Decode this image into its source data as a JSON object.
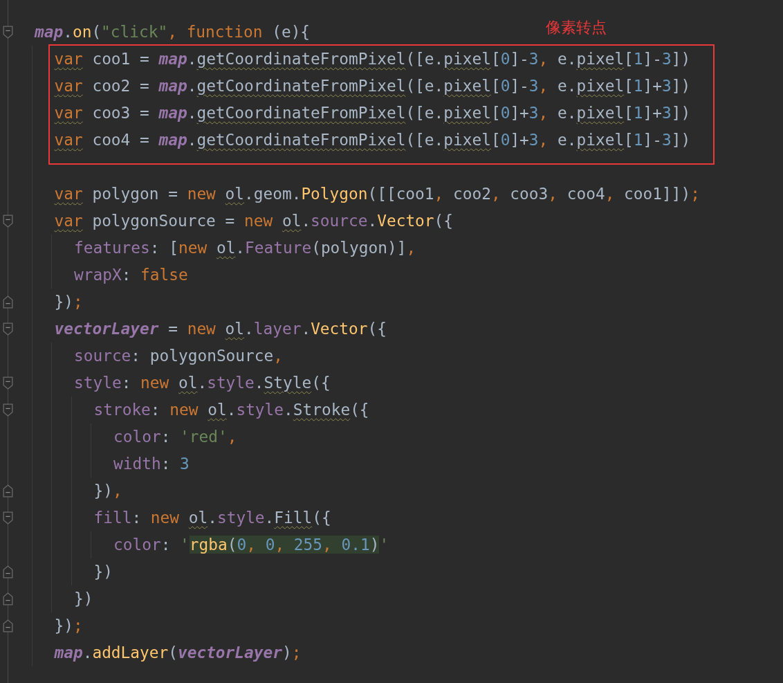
{
  "annotation": {
    "label": "像素转点"
  },
  "lines": [
    {
      "collapsible": true,
      "tokens": [
        {
          "kind": "glob",
          "text": "map"
        },
        {
          "kind": "id",
          "text": "."
        },
        {
          "kind": "fn",
          "text": "on"
        },
        {
          "kind": "id",
          "text": "("
        },
        {
          "kind": "str",
          "text": "\"click\""
        },
        {
          "kind": "sep",
          "text": ", "
        },
        {
          "kind": "kw",
          "text": "function"
        },
        {
          "kind": "id",
          "text": " (e){"
        }
      ],
      "children": [
        {
          "boxed": true,
          "tokens": [
            {
              "kind": "kw",
              "text": "var",
              "squiggle": true
            },
            {
              "kind": "id",
              "text": " coo1 = "
            },
            {
              "kind": "glob",
              "text": "map"
            },
            {
              "kind": "id",
              "text": "."
            },
            {
              "kind": "id",
              "text": "getCoordinateFromPixel",
              "squiggle": true
            },
            {
              "kind": "id",
              "text": "([e."
            },
            {
              "kind": "id",
              "text": "pixel",
              "squiggle": true
            },
            {
              "kind": "id",
              "text": "["
            },
            {
              "kind": "num",
              "text": "0"
            },
            {
              "kind": "id",
              "text": "]-"
            },
            {
              "kind": "num",
              "text": "3"
            },
            {
              "kind": "sep",
              "text": ","
            },
            {
              "kind": "id",
              "text": " e."
            },
            {
              "kind": "id",
              "text": "pixel",
              "squiggle": true
            },
            {
              "kind": "id",
              "text": "["
            },
            {
              "kind": "num",
              "text": "1"
            },
            {
              "kind": "id",
              "text": "]-"
            },
            {
              "kind": "num",
              "text": "3"
            },
            {
              "kind": "id",
              "text": "])"
            }
          ]
        },
        {
          "boxed": true,
          "tokens": [
            {
              "kind": "kw",
              "text": "var",
              "squiggle": true
            },
            {
              "kind": "id",
              "text": " coo2 = "
            },
            {
              "kind": "glob",
              "text": "map"
            },
            {
              "kind": "id",
              "text": "."
            },
            {
              "kind": "id",
              "text": "getCoordinateFromPixel",
              "squiggle": true
            },
            {
              "kind": "id",
              "text": "([e."
            },
            {
              "kind": "id",
              "text": "pixel",
              "squiggle": true
            },
            {
              "kind": "id",
              "text": "["
            },
            {
              "kind": "num",
              "text": "0"
            },
            {
              "kind": "id",
              "text": "]-"
            },
            {
              "kind": "num",
              "text": "3"
            },
            {
              "kind": "sep",
              "text": ","
            },
            {
              "kind": "id",
              "text": " e."
            },
            {
              "kind": "id",
              "text": "pixel",
              "squiggle": true
            },
            {
              "kind": "id",
              "text": "["
            },
            {
              "kind": "num",
              "text": "1"
            },
            {
              "kind": "id",
              "text": "]+"
            },
            {
              "kind": "num",
              "text": "3"
            },
            {
              "kind": "id",
              "text": "])"
            }
          ]
        },
        {
          "boxed": true,
          "tokens": [
            {
              "kind": "kw",
              "text": "var",
              "squiggle": true
            },
            {
              "kind": "id",
              "text": " coo3 = "
            },
            {
              "kind": "glob",
              "text": "map"
            },
            {
              "kind": "id",
              "text": "."
            },
            {
              "kind": "id",
              "text": "getCoordinateFromPixel",
              "squiggle": true
            },
            {
              "kind": "id",
              "text": "([e."
            },
            {
              "kind": "id",
              "text": "pixel",
              "squiggle": true
            },
            {
              "kind": "id",
              "text": "["
            },
            {
              "kind": "num",
              "text": "0"
            },
            {
              "kind": "id",
              "text": "]+"
            },
            {
              "kind": "num",
              "text": "3"
            },
            {
              "kind": "sep",
              "text": ","
            },
            {
              "kind": "id",
              "text": " e."
            },
            {
              "kind": "id",
              "text": "pixel",
              "squiggle": true
            },
            {
              "kind": "id",
              "text": "["
            },
            {
              "kind": "num",
              "text": "1"
            },
            {
              "kind": "id",
              "text": "]+"
            },
            {
              "kind": "num",
              "text": "3"
            },
            {
              "kind": "id",
              "text": "])"
            }
          ]
        },
        {
          "boxed": true,
          "tokens": [
            {
              "kind": "kw",
              "text": "var",
              "squiggle": true
            },
            {
              "kind": "id",
              "text": " coo4 = "
            },
            {
              "kind": "glob",
              "text": "map"
            },
            {
              "kind": "id",
              "text": "."
            },
            {
              "kind": "id",
              "text": "getCoordinateFromPixel",
              "squiggle": true
            },
            {
              "kind": "id",
              "text": "([e."
            },
            {
              "kind": "id",
              "text": "pixel",
              "squiggle": true
            },
            {
              "kind": "id",
              "text": "["
            },
            {
              "kind": "num",
              "text": "0"
            },
            {
              "kind": "id",
              "text": "]+"
            },
            {
              "kind": "num",
              "text": "3"
            },
            {
              "kind": "sep",
              "text": ","
            },
            {
              "kind": "id",
              "text": " e."
            },
            {
              "kind": "id",
              "text": "pixel",
              "squiggle": true
            },
            {
              "kind": "id",
              "text": "["
            },
            {
              "kind": "num",
              "text": "1"
            },
            {
              "kind": "id",
              "text": "]-"
            },
            {
              "kind": "num",
              "text": "3"
            },
            {
              "kind": "id",
              "text": "])"
            }
          ]
        },
        {
          "blank": true
        },
        {
          "tokens": [
            {
              "kind": "kw",
              "text": "var",
              "squiggle": true
            },
            {
              "kind": "id",
              "text": " polygon = "
            },
            {
              "kind": "kw",
              "text": "new "
            },
            {
              "kind": "id",
              "text": "ol",
              "squiggle": true
            },
            {
              "kind": "id",
              "text": ".geom."
            },
            {
              "kind": "fn",
              "text": "Polygon"
            },
            {
              "kind": "id",
              "text": "([[coo1"
            },
            {
              "kind": "sep",
              "text": ","
            },
            {
              "kind": "id",
              "text": " coo2"
            },
            {
              "kind": "sep",
              "text": ","
            },
            {
              "kind": "id",
              "text": " coo3"
            },
            {
              "kind": "sep",
              "text": ","
            },
            {
              "kind": "id",
              "text": " coo4"
            },
            {
              "kind": "sep",
              "text": ","
            },
            {
              "kind": "id",
              "text": " coo1]])"
            },
            {
              "kind": "sep",
              "text": ";"
            }
          ]
        },
        {
          "collapsible": true,
          "tokens": [
            {
              "kind": "kw",
              "text": "var",
              "squiggle": true
            },
            {
              "kind": "id",
              "text": " polygonSource = "
            },
            {
              "kind": "kw",
              "text": "new "
            },
            {
              "kind": "id",
              "text": "ol",
              "squiggle": true
            },
            {
              "kind": "id",
              "text": "."
            },
            {
              "kind": "prop",
              "text": "source"
            },
            {
              "kind": "id",
              "text": "."
            },
            {
              "kind": "fn",
              "text": "Vector"
            },
            {
              "kind": "id",
              "text": "({"
            }
          ],
          "children": [
            {
              "tokens": [
                {
                  "kind": "prop",
                  "text": "features"
                },
                {
                  "kind": "id",
                  "text": ": ["
                },
                {
                  "kind": "kw",
                  "text": "new "
                },
                {
                  "kind": "id",
                  "text": "ol",
                  "squiggle": true
                },
                {
                  "kind": "id",
                  "text": "."
                },
                {
                  "kind": "prop",
                  "text": "Feature"
                },
                {
                  "kind": "id",
                  "text": "(polygon)]"
                },
                {
                  "kind": "sep",
                  "text": ","
                }
              ]
            },
            {
              "tokens": [
                {
                  "kind": "prop",
                  "text": "wrapX"
                },
                {
                  "kind": "id",
                  "text": ": "
                },
                {
                  "kind": "kw",
                  "text": "false"
                }
              ]
            }
          ]
        },
        {
          "block_end": true,
          "tokens": [
            {
              "kind": "id",
              "text": "})"
            },
            {
              "kind": "sep",
              "text": ";"
            }
          ]
        },
        {
          "collapsible": true,
          "tokens": [
            {
              "kind": "glob",
              "text": "vectorLayer"
            },
            {
              "kind": "id",
              "text": " = "
            },
            {
              "kind": "kw",
              "text": "new "
            },
            {
              "kind": "id",
              "text": "ol",
              "squiggle": true
            },
            {
              "kind": "id",
              "text": "."
            },
            {
              "kind": "prop",
              "text": "layer"
            },
            {
              "kind": "id",
              "text": "."
            },
            {
              "kind": "fn",
              "text": "Vector"
            },
            {
              "kind": "id",
              "text": "({"
            }
          ],
          "children": [
            {
              "tokens": [
                {
                  "kind": "prop",
                  "text": "source"
                },
                {
                  "kind": "id",
                  "text": ": polygonSource"
                },
                {
                  "kind": "sep",
                  "text": ","
                }
              ]
            },
            {
              "collapsible": true,
              "tokens": [
                {
                  "kind": "prop",
                  "text": "style"
                },
                {
                  "kind": "id",
                  "text": ": "
                },
                {
                  "kind": "kw",
                  "text": "new "
                },
                {
                  "kind": "id",
                  "text": "ol",
                  "squiggle": true
                },
                {
                  "kind": "id",
                  "text": "."
                },
                {
                  "kind": "prop",
                  "text": "style"
                },
                {
                  "kind": "id",
                  "text": "."
                },
                {
                  "kind": "id",
                  "text": "Style",
                  "squiggle": true
                },
                {
                  "kind": "id",
                  "text": "({"
                }
              ],
              "children": [
                {
                  "collapsible": true,
                  "tokens": [
                    {
                      "kind": "prop",
                      "text": "stroke"
                    },
                    {
                      "kind": "id",
                      "text": ": "
                    },
                    {
                      "kind": "kw",
                      "text": "new "
                    },
                    {
                      "kind": "id",
                      "text": "ol",
                      "squiggle": true
                    },
                    {
                      "kind": "id",
                      "text": "."
                    },
                    {
                      "kind": "prop",
                      "text": "style"
                    },
                    {
                      "kind": "id",
                      "text": "."
                    },
                    {
                      "kind": "id",
                      "text": "Stroke",
                      "squiggle": true
                    },
                    {
                      "kind": "id",
                      "text": "({"
                    }
                  ],
                  "children": [
                    {
                      "tokens": [
                        {
                          "kind": "prop",
                          "text": "color"
                        },
                        {
                          "kind": "id",
                          "text": ": "
                        },
                        {
                          "kind": "str",
                          "text": "'red'"
                        },
                        {
                          "kind": "sep",
                          "text": ","
                        }
                      ]
                    },
                    {
                      "tokens": [
                        {
                          "kind": "prop",
                          "text": "width"
                        },
                        {
                          "kind": "id",
                          "text": ": "
                        },
                        {
                          "kind": "num",
                          "text": "3"
                        }
                      ]
                    }
                  ]
                },
                {
                  "block_end": true,
                  "tokens": [
                    {
                      "kind": "id",
                      "text": "})"
                    },
                    {
                      "kind": "sep",
                      "text": ","
                    }
                  ]
                },
                {
                  "collapsible": true,
                  "tokens": [
                    {
                      "kind": "prop",
                      "text": "fill"
                    },
                    {
                      "kind": "id",
                      "text": ": "
                    },
                    {
                      "kind": "kw",
                      "text": "new "
                    },
                    {
                      "kind": "id",
                      "text": "ol",
                      "squiggle": true
                    },
                    {
                      "kind": "id",
                      "text": "."
                    },
                    {
                      "kind": "prop",
                      "text": "style"
                    },
                    {
                      "kind": "id",
                      "text": "."
                    },
                    {
                      "kind": "id",
                      "text": "Fill",
                      "squiggle": true
                    },
                    {
                      "kind": "id",
                      "text": "({"
                    }
                  ],
                  "children": [
                    {
                      "tokens": [
                        {
                          "kind": "prop",
                          "text": "color"
                        },
                        {
                          "kind": "id",
                          "text": ": "
                        },
                        {
                          "kind": "str",
                          "text": "'"
                        },
                        {
                          "kind": "fn",
                          "text": "rgba",
                          "highlighted": true
                        },
                        {
                          "kind": "id",
                          "text": "(",
                          "highlighted": true
                        },
                        {
                          "kind": "num",
                          "text": "0",
                          "highlighted": true
                        },
                        {
                          "kind": "sep",
                          "text": ", ",
                          "highlighted": true
                        },
                        {
                          "kind": "num",
                          "text": "0",
                          "highlighted": true
                        },
                        {
                          "kind": "sep",
                          "text": ", ",
                          "highlighted": true
                        },
                        {
                          "kind": "num",
                          "text": "255",
                          "highlighted": true
                        },
                        {
                          "kind": "sep",
                          "text": ", ",
                          "highlighted": true
                        },
                        {
                          "kind": "num",
                          "text": "0.1",
                          "highlighted": true
                        },
                        {
                          "kind": "id",
                          "text": ")",
                          "highlighted": true
                        },
                        {
                          "kind": "str",
                          "text": "'"
                        }
                      ]
                    }
                  ]
                },
                {
                  "block_end": true,
                  "tokens": [
                    {
                      "kind": "id",
                      "text": "})"
                    }
                  ]
                }
              ]
            },
            {
              "block_end": true,
              "tokens": [
                {
                  "kind": "id",
                  "text": "})"
                }
              ]
            }
          ]
        },
        {
          "block_end": true,
          "tokens": [
            {
              "kind": "id",
              "text": "})"
            },
            {
              "kind": "sep",
              "text": ";"
            }
          ]
        },
        {
          "tokens": [
            {
              "kind": "glob",
              "text": "map"
            },
            {
              "kind": "id",
              "text": "."
            },
            {
              "kind": "fn",
              "text": "addLayer"
            },
            {
              "kind": "id",
              "text": "("
            },
            {
              "kind": "glob",
              "text": "vectorLayer"
            },
            {
              "kind": "id",
              "text": ")"
            },
            {
              "kind": "sep",
              "text": ";"
            }
          ]
        }
      ]
    }
  ]
}
